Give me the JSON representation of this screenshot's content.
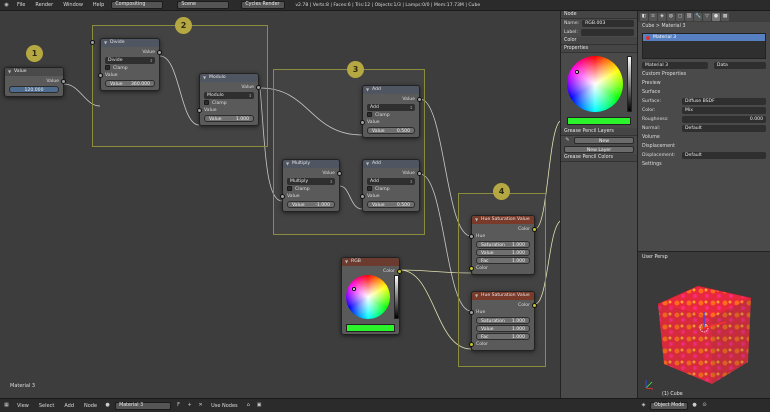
{
  "topbar": {
    "menus": [
      "File",
      "Render",
      "Window",
      "Help"
    ],
    "screen": "Compositing",
    "scene": "Scene",
    "engine": "Cycles Render",
    "stats": "v2.78 | Verts:8 | Faces:6 | Tris:12 | Objects:1/3 | Lamps:0/0 | Mem:17.73M | Cube"
  },
  "frames": {
    "f1": "1",
    "f2": "2",
    "f3": "3",
    "f4": "4"
  },
  "nodes": {
    "value": {
      "title": "Value",
      "out": "Value",
      "val": "120.000"
    },
    "divide": {
      "title": "Divide",
      "out": "Value",
      "op": "Divide",
      "clamp": "Clamp",
      "in1": "Value",
      "in2_label": "Value",
      "in2_val": "360.000"
    },
    "modulo": {
      "title": "Modulo",
      "out": "Value",
      "op": "Modulo",
      "clamp": "Clamp",
      "in1": "Value",
      "in2_label": "Value",
      "in2_val": "1.000"
    },
    "add1": {
      "title": "Add",
      "out": "Value",
      "op": "Add",
      "clamp": "Clamp",
      "in1": "Value",
      "in2_label": "Value",
      "in2_val": "0.500"
    },
    "multiply": {
      "title": "Multiply",
      "out": "Value",
      "op": "Multiply",
      "clamp": "Clamp",
      "in1": "Value",
      "in2_label": "Value",
      "in2_val": "-1.000"
    },
    "add2": {
      "title": "Add",
      "out": "Value",
      "op": "Add",
      "clamp": "Clamp",
      "in1": "Value",
      "in2_label": "Value",
      "in2_val": "0.500"
    },
    "hsv1": {
      "title": "Hue Saturation Value",
      "out": "Color",
      "hue": "Hue",
      "sat_label": "Saturation",
      "sat_val": "1.000",
      "val_label": "Value",
      "val_val": "1.000",
      "fac_label": "Fac",
      "fac_val": "1.000",
      "color": "Color"
    },
    "hsv2": {
      "title": "Hue Saturation Value",
      "out": "Color",
      "hue": "Hue",
      "sat_label": "Saturation",
      "sat_val": "1.000",
      "val_label": "Value",
      "val_val": "1.000",
      "fac_label": "Fac",
      "fac_val": "1.000",
      "color": "Color"
    },
    "rgb": {
      "title": "RGB",
      "out": "Color",
      "swatch": "#2cf42c"
    }
  },
  "editor": {
    "status": "Material 3"
  },
  "bottombar": {
    "menus": [
      "View",
      "Select",
      "Add",
      "Node"
    ],
    "material": "Material 3",
    "use_nodes": "Use Nodes"
  },
  "npanel": {
    "node_head": "Node",
    "name_label": "Name:",
    "name_val": "RGB.003",
    "label_label": "Label:",
    "color_head": "Color",
    "properties_head": "Properties",
    "gp_layers_head": "Grease Pencil Layers",
    "new_btn": "New",
    "new_layer_btn": "New Layer",
    "gp_colors_head": "Grease Pencil Colors",
    "swatch": "#2cf42c"
  },
  "props": {
    "breadcrumb": "Cube  >  Material 3",
    "material_item": "Material 3",
    "mat_field": "Material 3",
    "data_field": "Data",
    "sections": [
      "Custom Properties",
      "Preview",
      "Surface"
    ],
    "surface_label": "Surface:",
    "surface_val": "Diffuse BSDF",
    "color_label": "Color:",
    "color_val": "Mix",
    "rough_label": "Roughness:",
    "rough_val": "0.000",
    "normal_label": "Normal:",
    "normal_val": "Default",
    "volume": "Volume",
    "displacement_head": "Displacement",
    "disp_label": "Displacement:",
    "disp_val": "Default",
    "settings": "Settings"
  },
  "viewport": {
    "label": "User Persp",
    "object": "(1) Cube",
    "mode": "Object Mode"
  }
}
